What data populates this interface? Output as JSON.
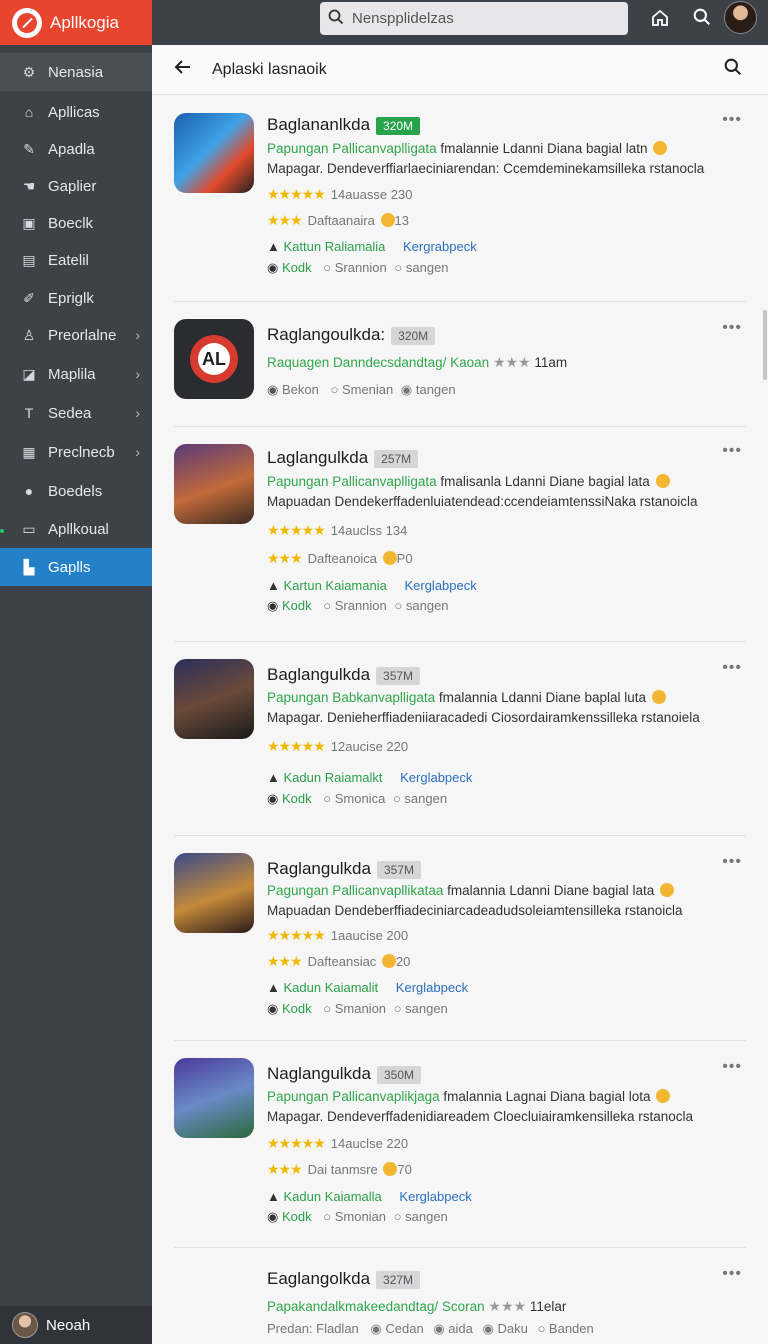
{
  "topbar": {
    "brand": "Apllkogia",
    "search_placeholder": "Nenspplidelzas"
  },
  "sidebar": {
    "items": [
      {
        "label": "Nenasia",
        "icon": "settings-icon"
      },
      {
        "label": "Apllicas",
        "icon": "home-icon"
      },
      {
        "label": "Apadla",
        "icon": "pencil-icon"
      },
      {
        "label": "Gaplier",
        "icon": "hand-icon"
      },
      {
        "label": "Boeclk",
        "icon": "square-icon"
      },
      {
        "label": "Eatelil",
        "icon": "image-icon"
      },
      {
        "label": "Epriglk",
        "icon": "pen-icon"
      },
      {
        "label": "Preorlalne",
        "icon": "user-icon"
      },
      {
        "label": "Maplila",
        "icon": "chart-icon"
      },
      {
        "label": "Sedea",
        "icon": "text-icon"
      },
      {
        "label": "Preclnecb",
        "icon": "image-icon"
      },
      {
        "label": "Boedels",
        "icon": "person-icon"
      },
      {
        "label": "Apllkoual",
        "icon": "window-icon"
      },
      {
        "label": "Gaplls",
        "icon": "apps-icon"
      }
    ],
    "footer_name": "Neoah"
  },
  "main": {
    "title": "Aplaski lasnaoik",
    "cards": [
      {
        "title": "Baglananlkda",
        "size": "320M",
        "desc1_green": "Papungan Pallicanvaplligata",
        "desc1_rest": " fmalannie Ldanni Diana bagial latn",
        "desc2": "Mapagar. Dendeverffiarlaeciniarendan: Ccemdeminekamsilleka  rstanocla",
        "rating_text": "14auasse  230",
        "rating2_text": "Daftaanaira",
        "rating2_num": "13",
        "link1": "Kattun Raliamalia",
        "link2": "Kergrabpeck",
        "meta1": "Kodk",
        "meta2": "Srannion",
        "meta3": "sangen"
      },
      {
        "title": "Raglangoulkda:",
        "size": "320M",
        "desc1_green": "Raquagen Danndecsdandtag/ Kaoan",
        "desc1_rest": "11am",
        "meta1": "Bekon",
        "meta2": "Smenian",
        "meta3": "tangen"
      },
      {
        "title": "Laglangulkda",
        "size": "257M",
        "desc1_green": "Papungan Pallicanvaplligata",
        "desc1_rest": " fmalisanla Ldanni Diane bagial lata",
        "desc2": "Mapuadan Dendekerffadenluiatendead:ccendeiamtenssiNaka  rstanoicla",
        "rating_text": "14auclss  134",
        "rating2_text": "Dafteanoica",
        "rating2_num": "P0",
        "link1": "Kartun Kaiamania",
        "link2": "Kerglabpeck",
        "meta1": "Kodk",
        "meta2": "Srannion",
        "meta3": "sangen"
      },
      {
        "title": "Baglangulkda",
        "size": "357M",
        "desc1_green": "Papungan Babkanvaplligata",
        "desc1_rest": " fmalannia Ldanni Diane baplal luta",
        "desc2": "Mapagar. Denieherffiadeniiaracadedi Ciosordairamkenssilleka  rstanoiela",
        "rating_text": "12aucise  220",
        "link1": "Kadun Raiamalkt",
        "link2": "Kerglabpeck",
        "meta1": "Kodk",
        "meta2": "Smonica",
        "meta3": "sangen"
      },
      {
        "title": "Raglangulkda",
        "size": "357M",
        "desc1_green": "Pagungan Pallicanvapllikataa",
        "desc1_rest": " fmalannia Ldanni Diane bagial lata",
        "desc2": "Mapuadan Dendeberffiadeciniarcadeadudsoleiamtensilleka  rstanoicla",
        "rating_text": "1aaucise  200",
        "rating2_text": "Dafteansiac",
        "rating2_num": "20",
        "link1": "Kadun Kaiamalit",
        "link2": "Kerglabpeck",
        "meta1": "Kodk",
        "meta2": "Smanion",
        "meta3": "sangen"
      },
      {
        "title": "Naglangulkda",
        "size": "350M",
        "desc1_green": "Papungan Pallicanvaplikjaga",
        "desc1_rest": " fmalannia Lagnai Diana bagial lota",
        "desc2": "Mapagar. Dendeverffadenidiareadem Cloecluiairamkensilleka  rstanocla",
        "rating_text": "14auclse  220",
        "rating2_text": "Dai tanmsre",
        "rating2_num": "70",
        "link1": "Kadun Kaiamalla",
        "link2": "Kerglabpeck",
        "meta1": "Kodk",
        "meta2": "Smonian",
        "meta3": "sangen"
      },
      {
        "title": "Eaglangolkda",
        "size": "327M",
        "desc1_green": "Papakandalkmakeedandtag/ Scoran",
        "desc1_rest": "11elar",
        "meta0": "Predan:  Fladlan",
        "meta1": "Cedan",
        "meta2": "aida",
        "meta3": "Daku",
        "meta4": "Banden"
      }
    ]
  }
}
